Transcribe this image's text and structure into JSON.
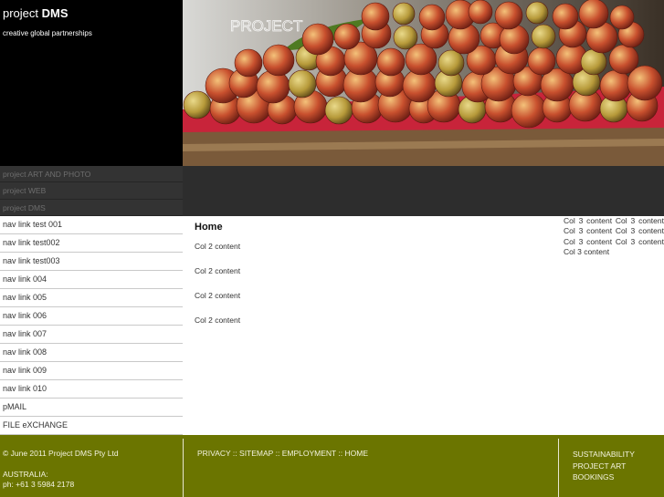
{
  "header": {
    "brand_prefix": "project",
    "brand_name": "DMS",
    "tagline": "creative global partnerships",
    "hero_watermark": "PROJECT"
  },
  "project_links": [
    "project ART AND PHOTO",
    "project WEB",
    "project DMS"
  ],
  "nav": [
    "nav link test 001",
    "nav link test002",
    "nav link test003",
    "nav link 004",
    "nav link 005",
    "nav link 006",
    "nav link 007",
    "nav link 008",
    "nav link 009",
    "nav link 010",
    "pMAIL",
    "FILE eXCHANGE"
  ],
  "main": {
    "heading": "Home",
    "paragraphs": [
      "Col 2 content",
      "Col 2 content",
      "Col 2 content",
      "Col 2 content"
    ]
  },
  "col3": "Col 3 content Col 3 content Col 3 content Col 3 content Col 3 content Col 3 content Col 3 content",
  "footer": {
    "copyright": "© June 2011 Project DMS Pty Ltd",
    "country": "AUSTRALIA:",
    "phone": "ph: +61 3 5984 2178",
    "links": [
      "PRIVACY",
      "SITEMAP",
      "EMPLOYMENT",
      "HOME"
    ],
    "separator": "::",
    "right_links": [
      "SUSTAINABILITY",
      "PROJECT ART",
      "BOOKINGS"
    ]
  },
  "colors": {
    "header_bg": "#000000",
    "project_bar_bg": "#2d2d2d",
    "footer_bg": "#6b7500"
  }
}
